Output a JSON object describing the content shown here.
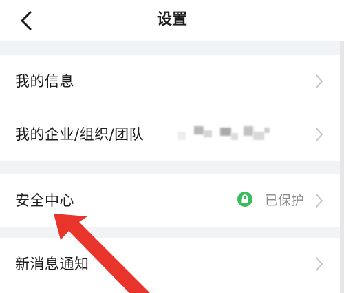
{
  "header": {
    "title": "设置",
    "back_icon": "chevron-left-icon"
  },
  "rows": [
    {
      "label": "我的信息"
    },
    {
      "label": "我的企业/组织/团队",
      "value_obscured": true
    },
    {
      "label": "安全中心",
      "status": "已保护",
      "status_icon": "lock-icon",
      "status_color": "#3cbb5e"
    },
    {
      "label": "新消息通知"
    }
  ],
  "colors": {
    "background": "#f2f3f5",
    "row": "#ffffff",
    "annotation_arrow": "#e8342a"
  }
}
